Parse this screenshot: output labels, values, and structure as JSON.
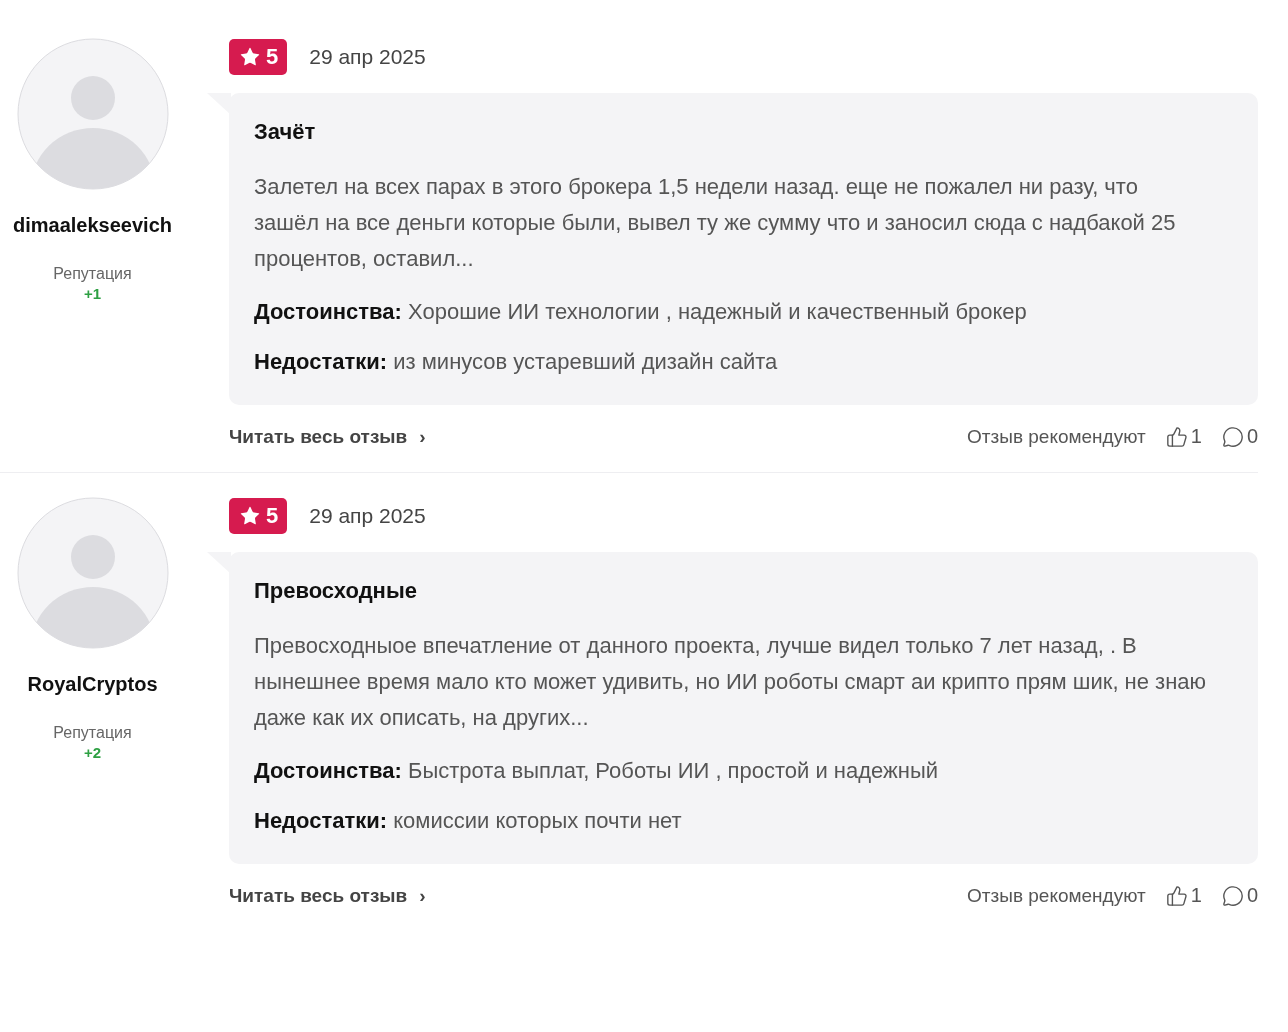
{
  "reviews": [
    {
      "author": "dimaalekseevich",
      "reputation_label": "Репутация",
      "reputation": "+1",
      "rating": "5",
      "date": "29 апр 2025",
      "title": "Зачёт",
      "text": "Залетел на всех парах в этого брокера 1,5 недели назад. еще не пожалел ни разу, что зашёл на все деньги которые были, вывел ту же сумму что и заносил сюда с надбакой 25 процентов, оставил...",
      "pros_label": "Достоинства:",
      "pros": "Хорошие ИИ технологии , надежный и качественный брокер",
      "cons_label": "Недостатки:",
      "cons": "из минусов устаревший дизайн сайта",
      "read_more": "Читать весь отзыв",
      "chevron": "›",
      "recommend_label": "Отзыв рекомендуют",
      "likes": "1",
      "comments": "0"
    },
    {
      "author": "RoyalCryptos",
      "reputation_label": "Репутация",
      "reputation": "+2",
      "rating": "5",
      "date": "29 апр 2025",
      "title": "Превосходные",
      "text": "Превосходныое впечатление от данного проекта, лучше видел только 7 лет назад, . В нынешнее время мало кто может удивить, но ИИ роботы смарт аи крипто прям шик, не знаю даже как их описать, на других...",
      "pros_label": "Достоинства:",
      "pros": "Быстрота выплат, Роботы ИИ , простой и надежный",
      "cons_label": "Недостатки:",
      "cons": "комиссии которых почти нет",
      "read_more": "Читать весь отзыв",
      "chevron": "›",
      "recommend_label": "Отзыв рекомендуют",
      "likes": "1",
      "comments": "0"
    }
  ]
}
